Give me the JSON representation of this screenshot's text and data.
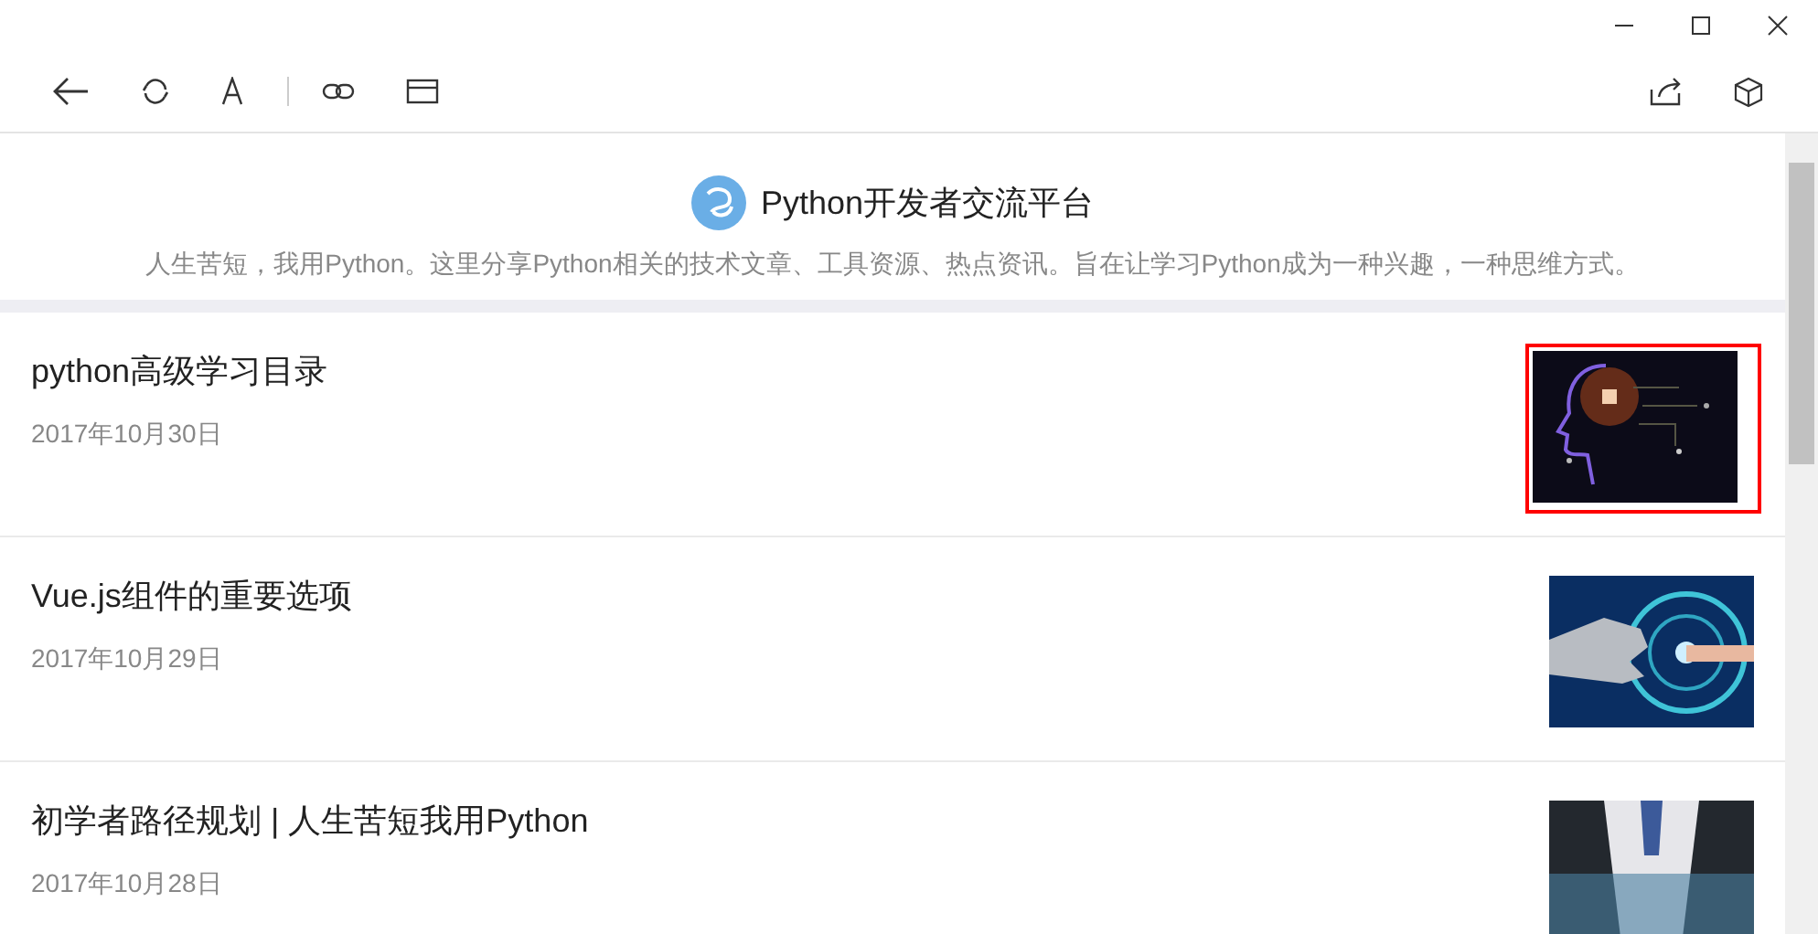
{
  "account": {
    "name": "Python开发者交流平台",
    "intro": "人生苦短，我用Python。这里分享Python相关的技术文章、工具资源、热点资讯。旨在让学习Python成为一种兴趣，一种思维方式。"
  },
  "articles": [
    {
      "title": "python高级学习目录",
      "date": "2017年10月30日",
      "highlighted": true,
      "kind": "picture"
    },
    {
      "title": "Vue.js组件的重要选项",
      "date": "2017年10月29日",
      "highlighted": false,
      "kind": "picture"
    },
    {
      "title": "初学者路径规划 | 人生苦短我用Python",
      "date": "2017年10月28日",
      "highlighted": false,
      "kind": "picture"
    }
  ]
}
